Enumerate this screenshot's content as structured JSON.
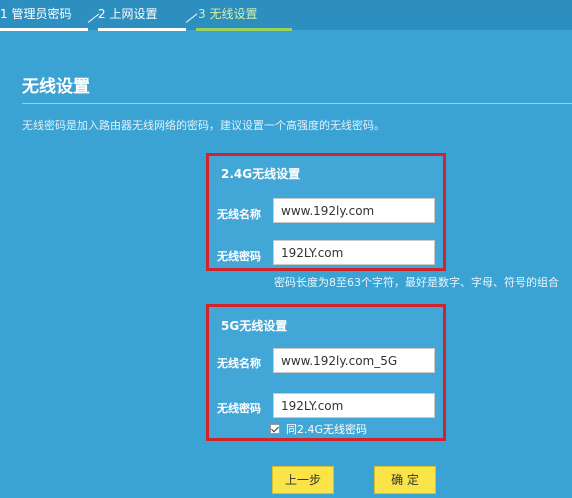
{
  "steps": [
    {
      "label": "1 管理员密码"
    },
    {
      "label": "2 上网设置"
    },
    {
      "label": "3 无线设置"
    }
  ],
  "page": {
    "title": "无线设置",
    "description": "无线密码是加入路由器无线网络的密码，建议设置一个高强度的无线密码。"
  },
  "band24": {
    "title": "2.4G无线设置",
    "ssid_label": "无线名称",
    "ssid_value": "www.192ly.com",
    "password_label": "无线密码",
    "password_value": "192LY.com",
    "hint": "密码长度为8至63个字符，最好是数字、字母、符号的组合"
  },
  "band5": {
    "title": "5G无线设置",
    "ssid_label": "无线名称",
    "ssid_value": "www.192ly.com_5G",
    "password_label": "无线密码",
    "password_value": "192LY.com",
    "same_password_label": "同2.4G无线密码",
    "same_password_checked": true
  },
  "buttons": {
    "prev": "上一步",
    "confirm": "确 定"
  },
  "colors": {
    "background": "#3aa3d3",
    "highlight_border": "#d0232b",
    "button": "#f9e547",
    "active_step": "#9ad35b"
  }
}
